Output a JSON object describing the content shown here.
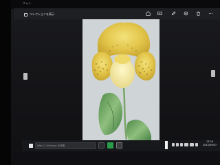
{
  "window": {
    "title": "フォト"
  },
  "app_bar": {
    "back_label": "コレクションを表示",
    "icons": [
      "home-icon",
      "slideshow-icon",
      "edit-icon",
      "enhance-icon",
      "delete-icon",
      "more-icon"
    ]
  },
  "taskbar": {
    "search_placeholder": "Web と Windows を検索",
    "time": "13:24",
    "date": "2015/09/07"
  },
  "colors": {
    "accent": "#2a9d4b",
    "taskbar": "#17181b",
    "app_bar": "#1e1f23"
  }
}
